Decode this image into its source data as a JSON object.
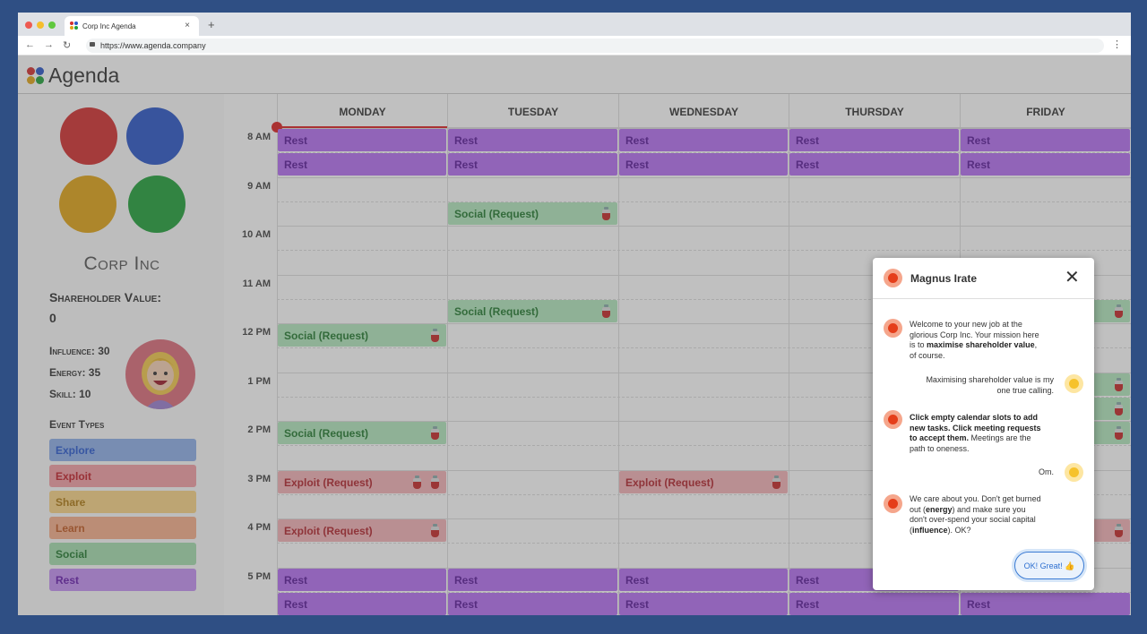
{
  "browser": {
    "tab_title": "Corp Inc Agenda",
    "new_tab": "+",
    "close_tab": "×",
    "url": "https://www.agenda.company",
    "back": "←",
    "forward": "→",
    "reload": "↻",
    "menu": "⋮"
  },
  "app": {
    "title": "Agenda"
  },
  "sidebar": {
    "company": "Corp Inc",
    "shareholder_label": "Shareholder Value:",
    "shareholder_value": "0",
    "influence": "Influence: 30",
    "energy": "Energy: 35",
    "skill": "Skill: 10",
    "event_types_title": "Event Types",
    "event_types": [
      "Explore",
      "Exploit",
      "Share",
      "Learn",
      "Social",
      "Rest"
    ]
  },
  "colors": {
    "red": "#d32f2f",
    "blue": "#2b57c8",
    "yellow": "#e2a416",
    "green": "#22a13a",
    "explore": "#8fb0ea",
    "exploit": "#f5a0a6",
    "share": "#fad587",
    "learn": "#f8b08c",
    "social": "#a6deb0",
    "rest": "#c592f4",
    "explore_text": "#2a5ad0",
    "exploit_text": "#c3202a",
    "share_text": "#b07a12",
    "learn_text": "#c25a22",
    "social_text": "#237a30",
    "rest_text": "#6a1fb0"
  },
  "calendar": {
    "days": [
      "MONDAY",
      "TUESDAY",
      "WEDNESDAY",
      "THURSDAY",
      "FRIDAY"
    ],
    "times": [
      "8 AM",
      "9 AM",
      "10 AM",
      "11 AM",
      "12 PM",
      "1 PM",
      "2 PM",
      "3 PM",
      "4 PM",
      "5 PM"
    ],
    "events": [
      {
        "day": 0,
        "slot": 0,
        "label": "Rest",
        "type": "rest",
        "jars": 0
      },
      {
        "day": 1,
        "slot": 0,
        "label": "Rest",
        "type": "rest",
        "jars": 0
      },
      {
        "day": 2,
        "slot": 0,
        "label": "Rest",
        "type": "rest",
        "jars": 0
      },
      {
        "day": 3,
        "slot": 0,
        "label": "Rest",
        "type": "rest",
        "jars": 0
      },
      {
        "day": 4,
        "slot": 0,
        "label": "Rest",
        "type": "rest",
        "jars": 0
      },
      {
        "day": 0,
        "slot": 1,
        "label": "Rest",
        "type": "rest",
        "jars": 0
      },
      {
        "day": 1,
        "slot": 1,
        "label": "Rest",
        "type": "rest",
        "jars": 0
      },
      {
        "day": 2,
        "slot": 1,
        "label": "Rest",
        "type": "rest",
        "jars": 0
      },
      {
        "day": 3,
        "slot": 1,
        "label": "Rest",
        "type": "rest",
        "jars": 0
      },
      {
        "day": 4,
        "slot": 1,
        "label": "Rest",
        "type": "rest",
        "jars": 0
      },
      {
        "day": 1,
        "slot": 3,
        "label": "Social (Request)",
        "type": "social",
        "jars": 1
      },
      {
        "day": 1,
        "slot": 7,
        "label": "Social (Request)",
        "type": "social",
        "jars": 1
      },
      {
        "day": 4,
        "slot": 7,
        "label": "",
        "type": "social",
        "jars": 1
      },
      {
        "day": 0,
        "slot": 8,
        "label": "Social (Request)",
        "type": "social",
        "jars": 1
      },
      {
        "day": 4,
        "slot": 10,
        "label": "",
        "type": "social",
        "jars": 1
      },
      {
        "day": 4,
        "slot": 11,
        "label": "",
        "type": "social",
        "jars": 1
      },
      {
        "day": 0,
        "slot": 12,
        "label": "Social (Request)",
        "type": "social",
        "jars": 1
      },
      {
        "day": 4,
        "slot": 12,
        "label": "",
        "type": "social",
        "jars": 1
      },
      {
        "day": 0,
        "slot": 14,
        "label": "Exploit (Request)",
        "type": "exploit",
        "jars": 2
      },
      {
        "day": 2,
        "slot": 14,
        "label": "Exploit (Request)",
        "type": "exploit",
        "jars": 1
      },
      {
        "day": 0,
        "slot": 16,
        "label": "Exploit (Request)",
        "type": "exploit",
        "jars": 1
      },
      {
        "day": 4,
        "slot": 16,
        "label": "",
        "type": "exploit",
        "jars": 1
      },
      {
        "day": 0,
        "slot": 18,
        "label": "Rest",
        "type": "rest",
        "jars": 0
      },
      {
        "day": 1,
        "slot": 18,
        "label": "Rest",
        "type": "rest",
        "jars": 0
      },
      {
        "day": 2,
        "slot": 18,
        "label": "Rest",
        "type": "rest",
        "jars": 0
      },
      {
        "day": 3,
        "slot": 18,
        "label": "Rest",
        "type": "rest",
        "jars": 0
      },
      {
        "day": 0,
        "slot": 19,
        "label": "Rest",
        "type": "rest",
        "jars": 0
      },
      {
        "day": 1,
        "slot": 19,
        "label": "Rest",
        "type": "rest",
        "jars": 0
      },
      {
        "day": 2,
        "slot": 19,
        "label": "Rest",
        "type": "rest",
        "jars": 0
      },
      {
        "day": 3,
        "slot": 19,
        "label": "Rest",
        "type": "rest",
        "jars": 0
      },
      {
        "day": 4,
        "slot": 19,
        "label": "Rest",
        "type": "rest",
        "jars": 0
      }
    ]
  },
  "dialog": {
    "sender": "Magnus Irate",
    "close": "✕",
    "msg1_pre": "Welcome to your new job at the glorious Corp Inc. Your mission here is to ",
    "msg1_bold": "maximise shareholder value",
    "msg1_post": ", of course.",
    "reply1": "Maximising shareholder value is my one true calling.",
    "msg2_bold": "Click empty calendar slots to add new tasks. Click meeting requests to accept them.",
    "msg2_post": " Meetings are the path to oneness.",
    "reply2": "Om.",
    "msg3_a": "We care about you. Don't get burned out (",
    "msg3_b": "energy",
    "msg3_c": ") and make sure you don't over-spend your social capital (",
    "msg3_d": "influence",
    "msg3_e": "). OK?",
    "ok_button": "OK! Great! 👍"
  }
}
